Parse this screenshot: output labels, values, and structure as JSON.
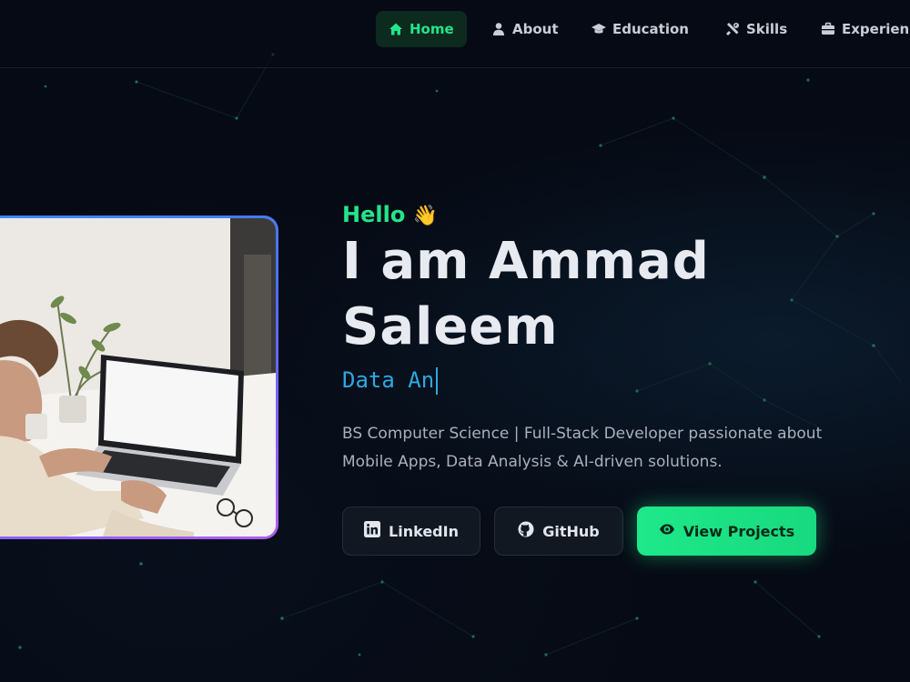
{
  "nav": {
    "items": [
      {
        "label": "Home",
        "icon": "home-icon",
        "active": true
      },
      {
        "label": "About",
        "icon": "user-icon",
        "active": false
      },
      {
        "label": "Education",
        "icon": "graduation-cap-icon",
        "active": false
      },
      {
        "label": "Skills",
        "icon": "tools-icon",
        "active": false
      },
      {
        "label": "Experience",
        "icon": "briefcase-icon",
        "active": false
      }
    ]
  },
  "hero": {
    "greeting": "Hello",
    "greeting_emoji": "👋",
    "name_line1": "I am Ammad",
    "name_line2": "Saleem",
    "typing_text": "Data An",
    "bio_line1": "BS Computer Science | Full-Stack Developer passionate about",
    "bio_line2": "Mobile Apps, Data Analysis & AI-driven solutions.",
    "buttons": {
      "linkedin": "LinkedIn",
      "github": "GitHub",
      "projects": "View Projects"
    }
  },
  "colors": {
    "accent": "#22e58a",
    "typing": "#2ea8e0",
    "background": "#060a14"
  }
}
